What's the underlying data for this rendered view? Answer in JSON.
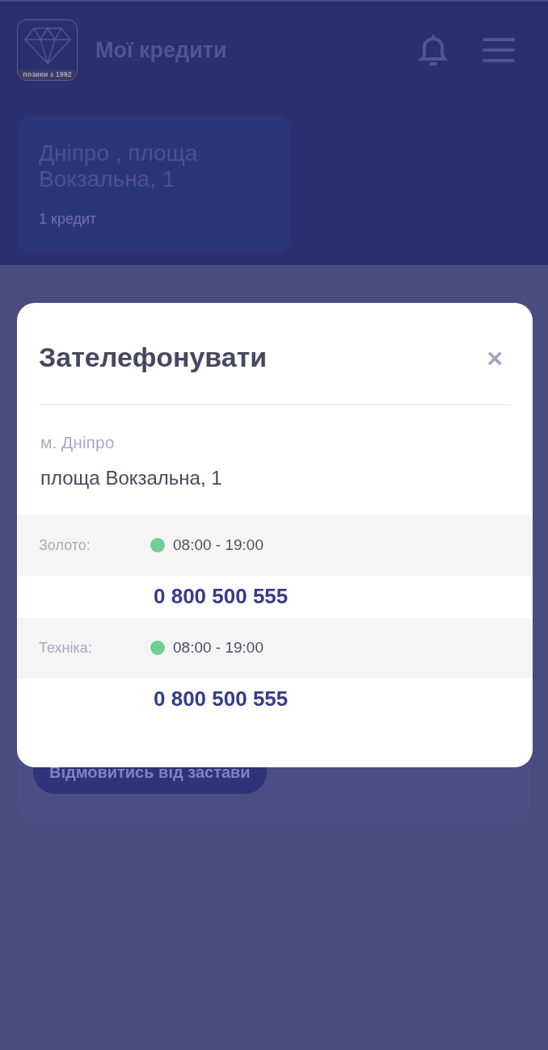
{
  "header": {
    "logo_caption": "позики з 1992",
    "title": "Мої кредити"
  },
  "branch_card": {
    "title": "Дніпро , площа Вокзальна, 1",
    "subtitle": "1 кредит"
  },
  "background_button": "Відмовитись від застави",
  "dialog": {
    "title": "Зателефонувати",
    "close": "×",
    "city": "м. Дніпро",
    "address": "площа Вокзальна, 1",
    "departments": [
      {
        "label": "Золото:",
        "color": "#6fcf97",
        "hours": "08:00 - 19:00",
        "phone": "0 800 500 555"
      },
      {
        "label": "Техніка:",
        "color": "#6fcf97",
        "hours": "08:00 - 19:00",
        "phone": "0 800 500 555"
      }
    ]
  }
}
